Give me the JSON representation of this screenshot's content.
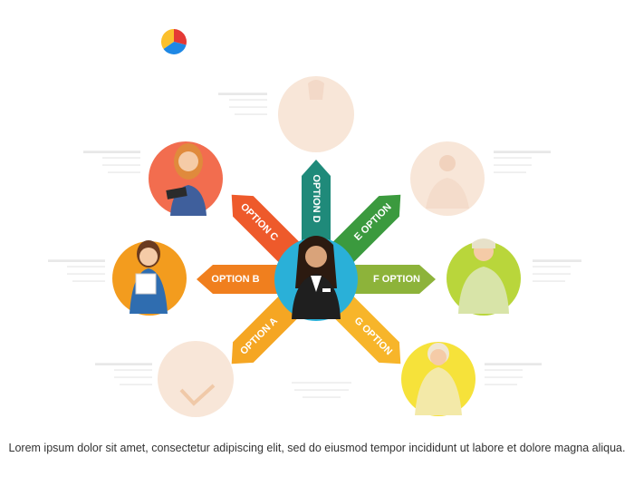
{
  "header": {
    "left_title": "",
    "right_title": ""
  },
  "options": [
    {
      "key": "a",
      "label": "OPTION A",
      "color": "#f5a623"
    },
    {
      "key": "b",
      "label": "OPTION B",
      "color": "#f07f1e"
    },
    {
      "key": "c",
      "label": "OPTION C",
      "color": "#ee5a2b"
    },
    {
      "key": "d",
      "label": "OPTION D",
      "color": "#1f8a7a"
    },
    {
      "key": "e",
      "label": "E OPTION",
      "color": "#3b9a3e"
    },
    {
      "key": "f",
      "label": "F OPTION",
      "color": "#8db33a"
    },
    {
      "key": "g",
      "label": "G OPTION",
      "color": "#f7b52a"
    }
  ],
  "colors": {
    "center_circle": "#2ab0d8",
    "circle_orange": "#f39c1e",
    "circle_coral": "#f26d4f",
    "circle_green": "#b9d63b",
    "circle_yellow": "#f6e23a",
    "circle_faded": "#f8e6d8"
  },
  "footer_text": "Lorem ipsum dolor sit amet, consectetur adipiscing elit, sed do eiusmod tempor incididunt ut labore et dolore magna aliqua."
}
